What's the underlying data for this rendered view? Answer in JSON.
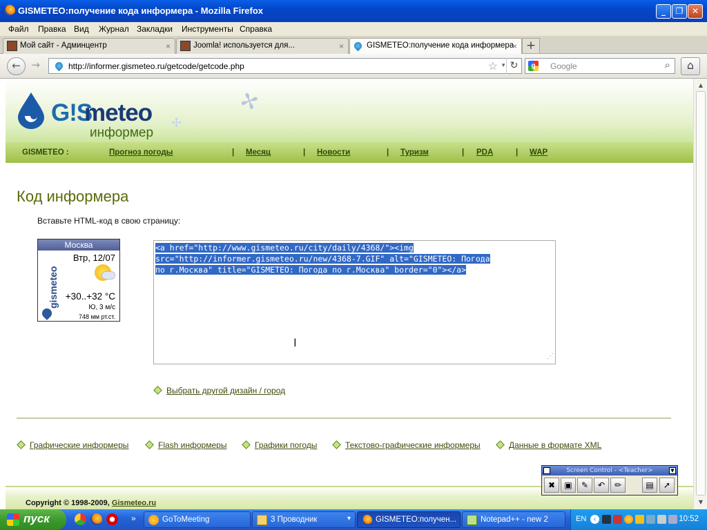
{
  "window": {
    "title": "GISMETEO:получение кода информера - Mozilla Firefox",
    "minimize_glyph": "_",
    "restore_glyph": "❐",
    "close_glyph": "✕"
  },
  "menu": [
    "Файл",
    "Правка",
    "Вид",
    "Журнал",
    "Закладки",
    "Инструменты",
    "Справка"
  ],
  "tabs": [
    {
      "label": "Мой сайт - Админцентр",
      "active": false
    },
    {
      "label": "Joomla! используется для...",
      "active": false
    },
    {
      "label": "GISMETEO:получение кода информера",
      "active": true
    }
  ],
  "tab_close_glyph": "×",
  "newtab_glyph": "+",
  "nav": {
    "back_glyph": "←",
    "forward_glyph": "→",
    "url": "http://informer.gismeteo.ru/getcode/getcode.php",
    "star_glyph": "☆",
    "reload_glyph": "↻",
    "search_placeholder": "Google",
    "search_engine_glyph": "g",
    "search_glyph": "⌕",
    "home_glyph": "⌂"
  },
  "site": {
    "logo_main": "G!S",
    "logo_meteo": "meteo",
    "logo_sub": "информер",
    "nav_label": "GISMETEO :",
    "nav_links": [
      "Прогноз погоды",
      "Месяц",
      "Новости",
      "Туризм",
      "PDA",
      "WAP"
    ],
    "nav_separator": "|",
    "heading": "Код информера",
    "instruction": "Вставьте HTML-код в свою страницу:",
    "informer": {
      "city": "Москва",
      "vertical_logo": "gismeteo",
      "date": "Втр, 12/07",
      "temperature": "+30..+32 °C",
      "wind": "Ю, 3 м/с",
      "pressure": "748 мм рт.ст."
    },
    "code_lines": [
      "<a href=\"http://www.gismeteo.ru/city/daily/4368/\"><img",
      "src=\"http://informer.gismeteo.ru/new/4368-7.GIF\" alt=\"GISMETEO: Погода",
      "по г.Москва\" title=\"GISMETEO: Погода по г.Москва\" border=\"0\"></a>"
    ],
    "resize_grip": "⋰",
    "text_cursor": "I",
    "other_design_link": "Выбрать другой дизайн / город",
    "bottom_links": [
      "Графические информеры",
      "Flash информеры",
      "Графики погоды",
      "Текстово-графические информеры",
      "Данные в формате XML"
    ],
    "copyright_text": "Copyright © 1998-2009,",
    "copyright_link": "Gismeteo.ru"
  },
  "screen_control": {
    "title": "Screen Control - <Teacher>",
    "dropdown_glyph": "▼"
  },
  "taskbar": {
    "start_label": "пуск",
    "more_glyph": "»",
    "buttons": [
      {
        "label": "GoToMeeting",
        "active": false
      },
      {
        "label": "3 Проводник",
        "active": false
      },
      {
        "label": "GISMETEO:получен...",
        "active": true
      },
      {
        "label": "Notepad++ - new 2",
        "active": false
      }
    ],
    "explorer_dropdown_glyph": "▾",
    "language": "EN",
    "clock": "10:52"
  },
  "colors": {
    "titlebar": "#0347c9",
    "site_green": "#9ec047",
    "heading_olive": "#5a6a0a",
    "selection_blue": "#3169c6"
  }
}
